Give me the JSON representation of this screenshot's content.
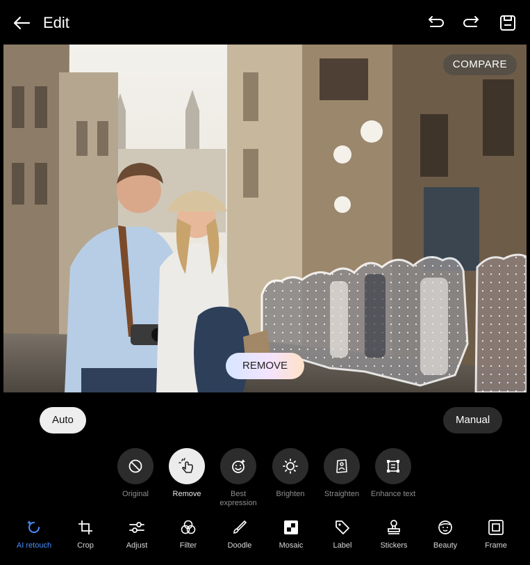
{
  "header": {
    "title": "Edit"
  },
  "photo": {
    "compare_label": "COMPARE",
    "remove_label": "REMOVE"
  },
  "mode": {
    "auto_label": "Auto",
    "manual_label": "Manual"
  },
  "tools": [
    {
      "label": "Original",
      "icon": "prohibited-icon"
    },
    {
      "label": "Remove",
      "icon": "hand-tap-icon",
      "active": true
    },
    {
      "label": "Best\nexpression",
      "icon": "smile-sparkle-icon"
    },
    {
      "label": "Brighten",
      "icon": "sun-sparkle-icon"
    },
    {
      "label": "Straighten",
      "icon": "person-straighten-icon"
    },
    {
      "label": "Enhance text",
      "icon": "document-frame-icon"
    }
  ],
  "nav": [
    {
      "label": "AI retouch",
      "icon": "ai-rotate-icon",
      "active": true
    },
    {
      "label": "Crop",
      "icon": "crop-icon"
    },
    {
      "label": "Adjust",
      "icon": "sliders-icon"
    },
    {
      "label": "Filter",
      "icon": "circles-icon"
    },
    {
      "label": "Doodle",
      "icon": "brush-icon"
    },
    {
      "label": "Mosaic",
      "icon": "mosaic-icon"
    },
    {
      "label": "Label",
      "icon": "tag-icon"
    },
    {
      "label": "Stickers",
      "icon": "stamp-icon"
    },
    {
      "label": "Beauty",
      "icon": "face-icon"
    },
    {
      "label": "Frame",
      "icon": "frame-icon"
    }
  ],
  "colors": {
    "accent": "#4a8fff",
    "background": "#000000"
  }
}
